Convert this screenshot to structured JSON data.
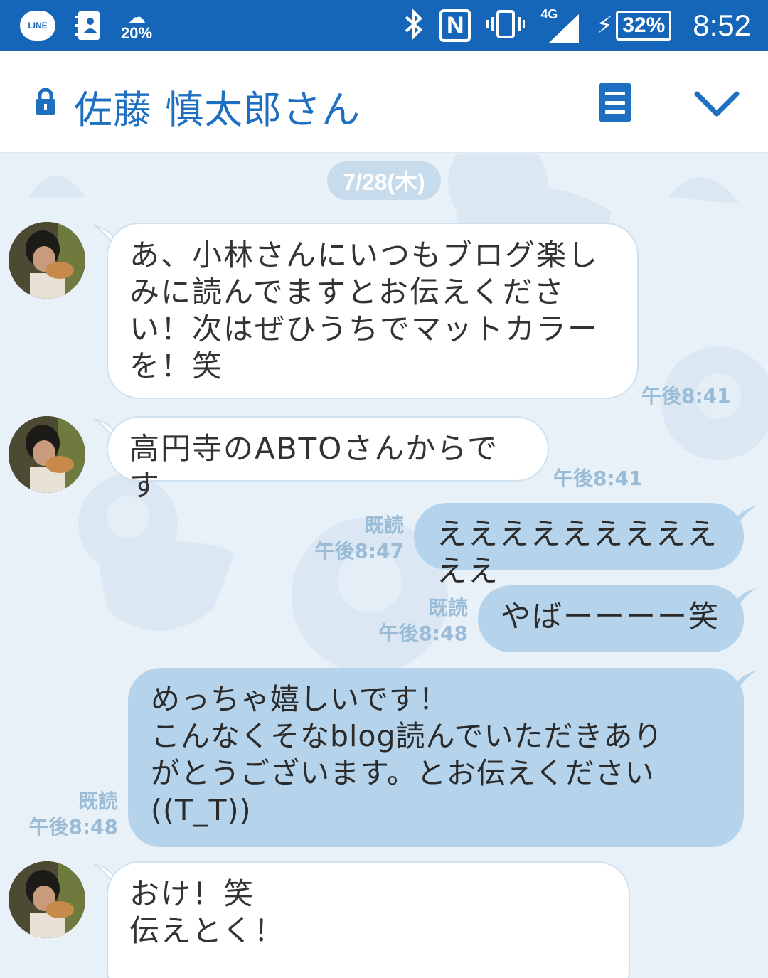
{
  "status_bar": {
    "line_label": "LINE",
    "weather_percent": "20%",
    "network": "4G",
    "battery": "32%",
    "time": "8:52"
  },
  "header": {
    "title": "佐藤 慎太郎さん"
  },
  "chat": {
    "date": "7/28(木)",
    "messages": [
      {
        "direction": "in",
        "text": "あ、小林さんにいつもブログ楽し\nみに読んでますとお伝えくださ\nい！次はぜひうちでマットカラー\nを！笑",
        "time": "午後8:41"
      },
      {
        "direction": "in",
        "text": "高円寺のABTOさんからです",
        "time": "午後8:41"
      },
      {
        "direction": "out",
        "text": "えええええええええええ",
        "read": "既読",
        "time": "午後8:47"
      },
      {
        "direction": "out",
        "text": "やばーーーー笑",
        "read": "既読",
        "time": "午後8:48"
      },
      {
        "direction": "out",
        "text": "めっちゃ嬉しいです！\nこんなくそなblog読んでいただきあり\nがとうございます。とお伝えください\n((T_T))",
        "read": "既読",
        "time": "午後8:48"
      },
      {
        "direction": "in",
        "text": "おけ！笑\n伝えとく！",
        "time": ""
      }
    ]
  },
  "colors": {
    "status_bar": "#1565b8",
    "accent": "#1f6fc0",
    "outgoing_bubble": "#b5d4ec",
    "chat_background": "#e9f1f8",
    "meta_text": "#9bbcd6"
  }
}
